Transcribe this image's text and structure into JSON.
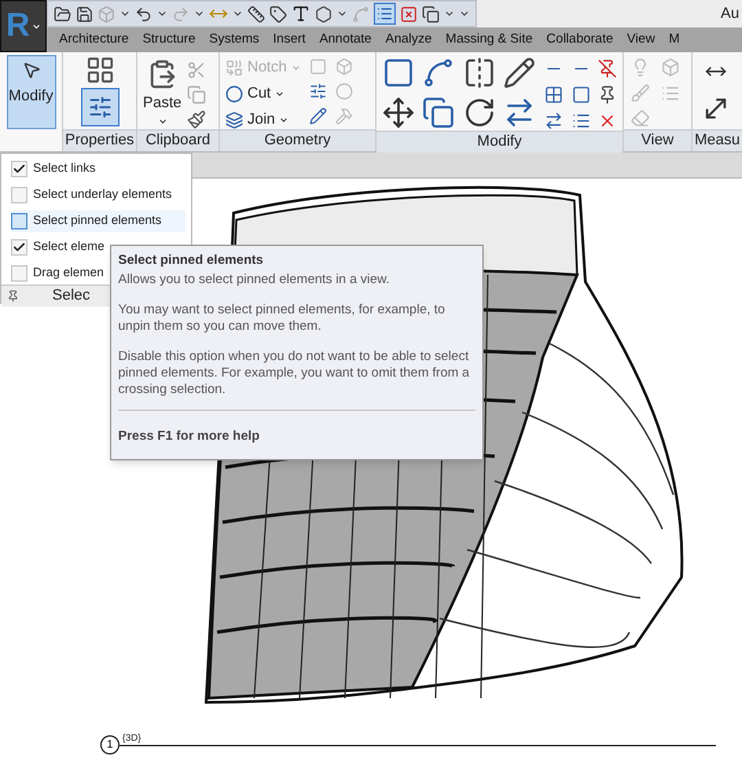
{
  "app_button": {
    "label": "R"
  },
  "title": "Au",
  "quick_access": {
    "thin_lines_on": true
  },
  "tabs": [
    {
      "label": "Architecture"
    },
    {
      "label": "Structure"
    },
    {
      "label": "Systems"
    },
    {
      "label": "Insert"
    },
    {
      "label": "Annotate"
    },
    {
      "label": "Analyze"
    },
    {
      "label": "Massing & Site"
    },
    {
      "label": "Collaborate"
    },
    {
      "label": "View"
    },
    {
      "label": "M"
    }
  ],
  "ribbon": {
    "modify_button": {
      "label": "Modify",
      "selected": true
    },
    "properties_button": {
      "selected": true
    },
    "paste_button": {
      "label": "Paste"
    },
    "geometry_buttons": [
      {
        "label": "Notch",
        "disabled": true
      },
      {
        "label": "Cut",
        "disabled": false
      },
      {
        "label": "Join",
        "disabled": false
      }
    ],
    "panels": [
      {
        "label": "Properties"
      },
      {
        "label": "Clipboard"
      },
      {
        "label": "Geometry"
      },
      {
        "label": "Modify"
      },
      {
        "label": "View"
      },
      {
        "label": "Measu"
      }
    ]
  },
  "select_panel": {
    "items": [
      {
        "label": "Select links",
        "checked": true,
        "highlighted": false
      },
      {
        "label": "Select underlay elements",
        "checked": false,
        "highlighted": false
      },
      {
        "label": "Select pinned elements",
        "checked": false,
        "highlighted": true
      },
      {
        "label": "Select eleme",
        "checked": true,
        "highlighted": false
      },
      {
        "label": "Drag elemen",
        "checked": false,
        "highlighted": false
      }
    ],
    "label": "Selec"
  },
  "tooltip": {
    "title": "Select pinned elements",
    "paragraphs": [
      "Allows you to select pinned elements in a view.",
      "You may want to select pinned elements, for example, to unpin them so you can move them.",
      "Disable this option when you do not want to be able to select pinned elements. For example, you want to omit them from a crossing selection."
    ],
    "footer": "Press F1 for more help"
  },
  "view_title": {
    "number": "1",
    "name": "{3D}"
  }
}
